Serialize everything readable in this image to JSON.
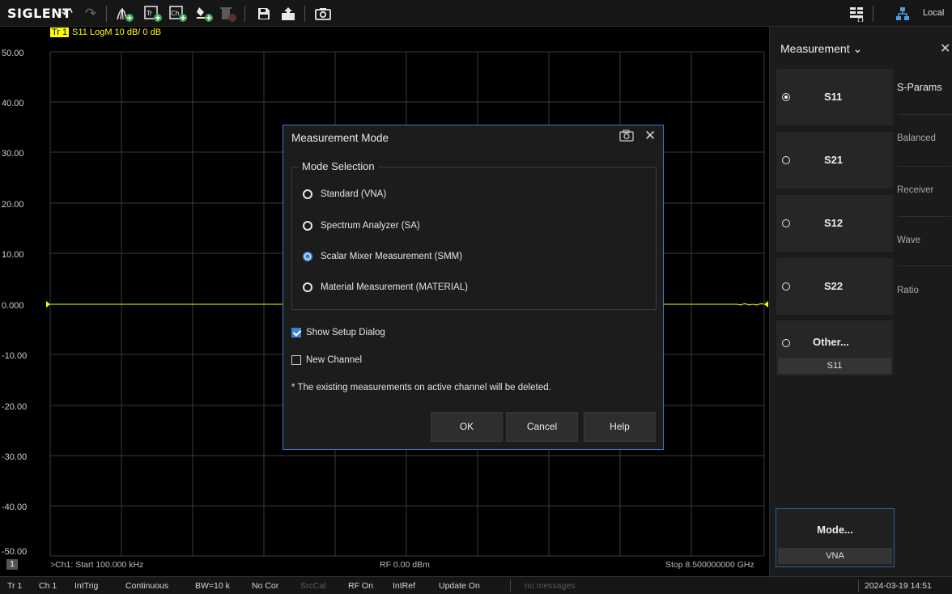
{
  "toolbar": {
    "logo": "SIGLENT",
    "local": "Local",
    "icons": [
      "undo-icon",
      "redo-icon",
      "add-marker-icon",
      "add-trace-icon",
      "add-channel-icon",
      "add-bucket-icon",
      "delete-icon",
      "save-icon",
      "recall-icon",
      "screenshot-icon",
      "layout-icon",
      "network-icon"
    ]
  },
  "plot": {
    "trace_tag": "Tr 1",
    "trace_label": "S11 LogM 10 dB/ 0 dB",
    "y_ticks": [
      "50.00",
      "40.00",
      "30.00",
      "20.00",
      "10.00",
      "0.000",
      "-10.00",
      "-20.00",
      "-30.00",
      "-40.00",
      "-50.00"
    ],
    "trace_color": "#ffff00",
    "channel_number": "1",
    "start": ">Ch1: Start 100.000 kHz",
    "power": "RF 0.00 dBm",
    "stop": "Stop 8.500000000 GHz"
  },
  "dialog": {
    "title": "Measurement Mode",
    "group_label": "Mode Selection",
    "options": [
      {
        "label": "Standard (VNA)",
        "selected": false
      },
      {
        "label": "Spectrum Analyzer (SA)",
        "selected": false
      },
      {
        "label": "Scalar Mixer Measurement (SMM)",
        "selected": true
      },
      {
        "label": "Material Measurement (MATERIAL)",
        "selected": false
      }
    ],
    "show_setup": {
      "label": "Show Setup Dialog",
      "checked": true
    },
    "new_channel": {
      "label": "New Channel",
      "checked": false
    },
    "note": "* The existing measurements on active channel will be deleted.",
    "ok": "OK",
    "cancel": "Cancel",
    "help": "Help",
    "accent": "#3b82d8"
  },
  "panel": {
    "title": "Measurement ⌄",
    "params": [
      {
        "label": "S11",
        "selected": true
      },
      {
        "label": "S21",
        "selected": false
      },
      {
        "label": "S12",
        "selected": false
      },
      {
        "label": "S22",
        "selected": false
      }
    ],
    "other_label": "Other...",
    "other_value": "S11",
    "categories": [
      "S-Params",
      "Balanced",
      "Receiver",
      "Wave",
      "Ratio"
    ],
    "mode_label": "Mode...",
    "mode_value": "VNA"
  },
  "status": {
    "trace": "Tr 1",
    "channel": "Ch 1",
    "trigger": "IntTrig",
    "sweep": "Continuous",
    "bw": "BW=10 k",
    "cor": "No Cor",
    "srccal": "SrcCal",
    "rf": "RF On",
    "ref": "IntRef",
    "update": "Update On",
    "messages": "no messages",
    "datetime": "2024-03-19 14:51"
  }
}
